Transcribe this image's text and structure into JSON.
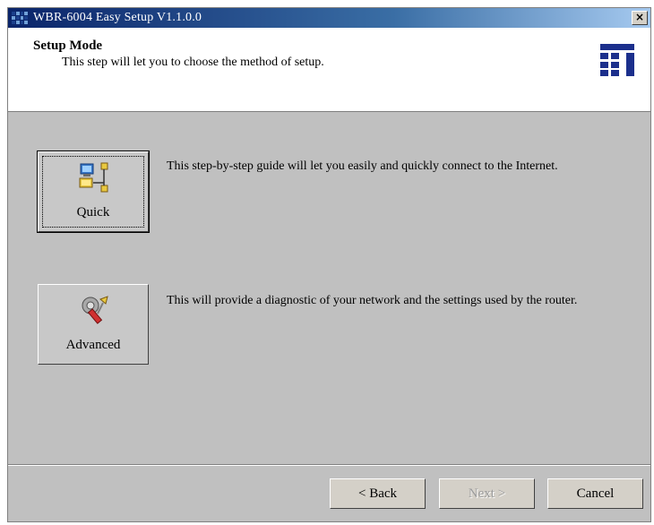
{
  "window": {
    "title": "WBR-6004 Easy Setup  V1.1.0.0",
    "close_label": "×"
  },
  "header": {
    "title": "Setup Mode",
    "subtitle": "This step will let you to choose the method of setup."
  },
  "options": [
    {
      "label": "Quick",
      "description": "This step-by-step guide will let you easily and quickly connect to the Internet.",
      "icon": "network-computers-icon"
    },
    {
      "label": "Advanced",
      "description": "This will provide a diagnostic of your network and the settings used by the router.",
      "icon": "wrench-tools-icon"
    }
  ],
  "footer": {
    "back_label": "< Back",
    "next_label": "Next >",
    "cancel_label": "Cancel"
  },
  "colors": {
    "titlebar": "#0a246a",
    "face": "#c0c0c0",
    "logo": "#1b2f8c"
  }
}
